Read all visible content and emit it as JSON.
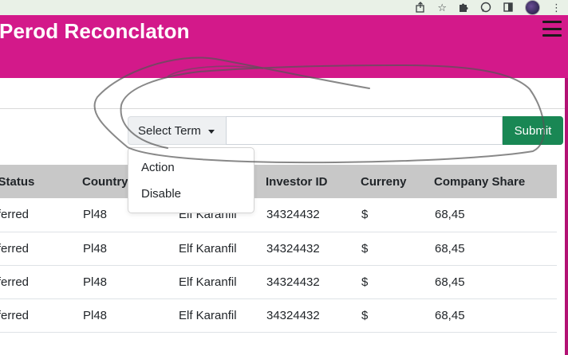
{
  "app": {
    "title": "Perod Reconclaton"
  },
  "browser": {
    "icons": [
      "share-icon",
      "star-icon",
      "puzzle-icon",
      "whatsapp-icon",
      "sidepanel-icon",
      "profile-avatar",
      "more-icon"
    ]
  },
  "search": {
    "term_button_label": "Select Term",
    "input_value": "",
    "input_placeholder": "",
    "submit_label": "Submit"
  },
  "dropdown": {
    "items": [
      {
        "label": "Action"
      },
      {
        "label": "Disable"
      }
    ]
  },
  "table": {
    "columns": [
      "m Status",
      "Country",
      "",
      "Investor ID",
      "Curreny",
      "Company Share"
    ],
    "rows": [
      [
        "nsferred",
        "Pl48",
        "Elf Karanfil",
        "34324432",
        "$",
        "68,45"
      ],
      [
        "nsferred",
        "Pl48",
        "Elf Karanfil",
        "34324432",
        "$",
        "68,45"
      ],
      [
        "nsferred",
        "Pl48",
        "Elf Karanfil",
        "34324432",
        "$",
        "68,45"
      ],
      [
        "nsferred",
        "Pl48",
        "Elf Karanfil",
        "34324432",
        "$",
        "68,45"
      ]
    ]
  },
  "colors": {
    "header_bg": "#d3198a",
    "submit_bg": "#198754",
    "table_header_bg": "#c8c8c8",
    "browser_bar_bg": "#e9f1e7"
  }
}
